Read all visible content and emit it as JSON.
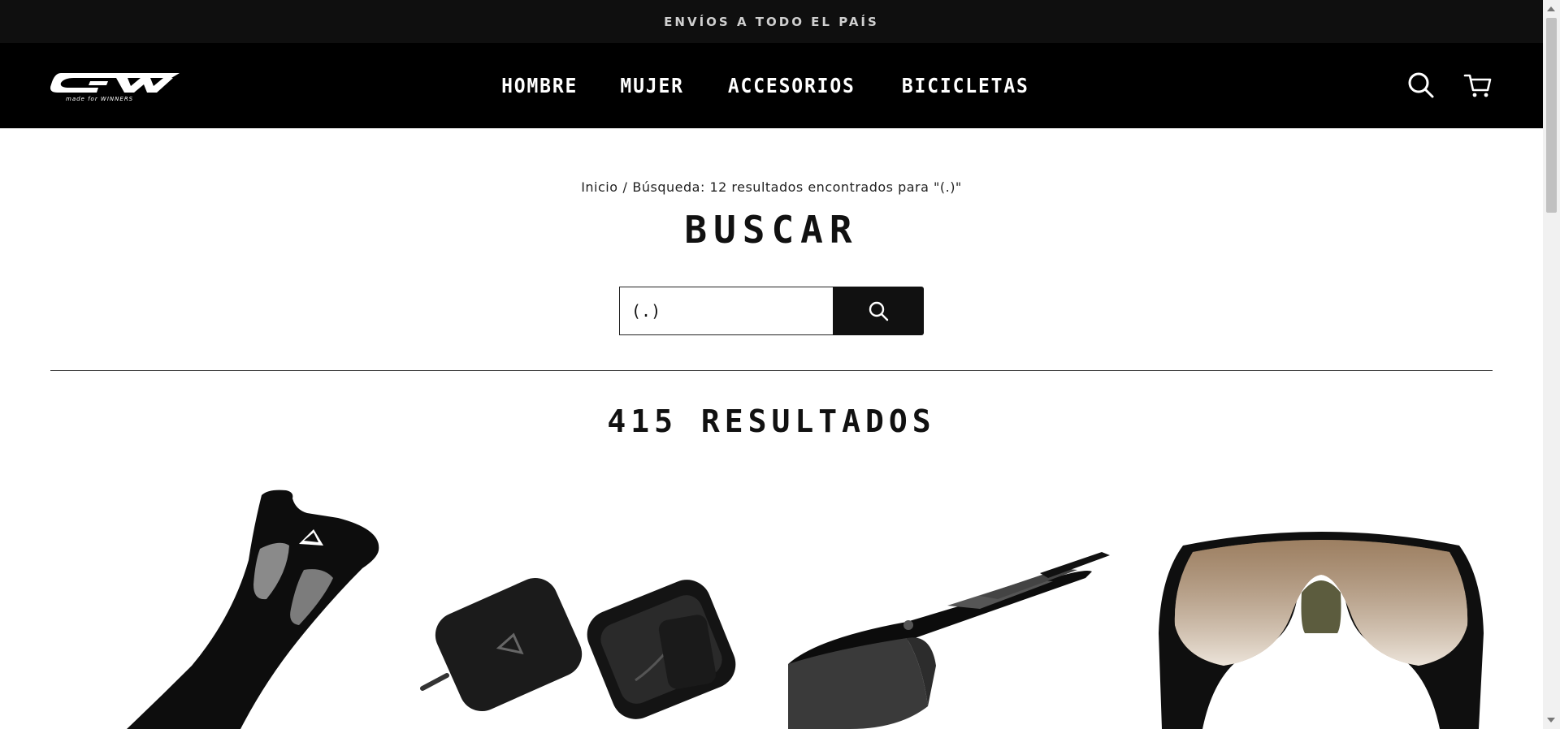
{
  "announcement": "ENVÍOS A TODO EL PAÍS",
  "header": {
    "logo_text": "GW",
    "logo_tagline": "made for WINNERS",
    "nav": [
      {
        "label": "HOMBRE"
      },
      {
        "label": "MUJER"
      },
      {
        "label": "ACCESORIOS"
      },
      {
        "label": "BICICLETAS"
      }
    ],
    "search_icon": "search-icon",
    "cart_icon": "cart-icon"
  },
  "breadcrumb": {
    "home": "Inicio",
    "separator": "/",
    "current": "Búsqueda: 12 resultados encontrados para \"(.)\""
  },
  "page_title": "BUSCAR",
  "search": {
    "value": "(.)",
    "button_icon": "search-icon"
  },
  "results_heading": "415 RESULTADOS",
  "products": [
    {
      "icon": "saddle-cover-image"
    },
    {
      "icon": "bike-bag-image"
    },
    {
      "icon": "sport-sunglasses-black-image"
    },
    {
      "icon": "sport-sunglasses-bronze-image"
    }
  ],
  "colors": {
    "announce_bg": "#0f0f0f",
    "header_bg": "#000000",
    "text": "#111111",
    "button_bg": "#111111"
  }
}
